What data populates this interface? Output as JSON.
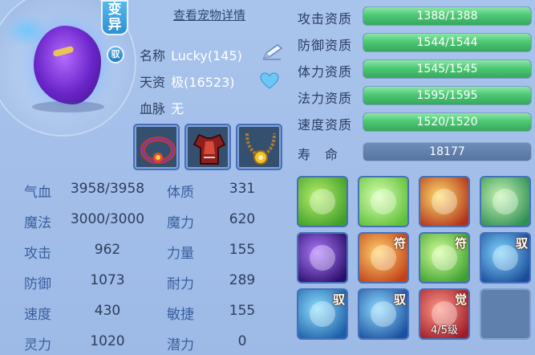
{
  "pet": {
    "mutant_tag": "变异",
    "ride_badge": "驭",
    "details_link": "查看宠物详情",
    "name_label": "名称",
    "name_value": "Lucky(145)",
    "talent_label": "天资",
    "talent_value": "极(16523)",
    "bloodline_label": "血脉",
    "bloodline_value": "无"
  },
  "attributes": [
    {
      "label": "气血",
      "value": "3958/3958"
    },
    {
      "label": "魔法",
      "value": "3000/3000"
    },
    {
      "label": "攻击",
      "value": "962"
    },
    {
      "label": "防御",
      "value": "1073"
    },
    {
      "label": "速度",
      "value": "430"
    },
    {
      "label": "灵力",
      "value": "1020"
    }
  ],
  "stats": [
    {
      "label": "体质",
      "value": "331"
    },
    {
      "label": "魔力",
      "value": "620"
    },
    {
      "label": "力量",
      "value": "155"
    },
    {
      "label": "耐力",
      "value": "289"
    },
    {
      "label": "敏捷",
      "value": "155"
    },
    {
      "label": "潜力",
      "value": "0"
    }
  ],
  "aptitudes": [
    {
      "label": "攻击资质",
      "text": "1388/1388",
      "fill": 1.0
    },
    {
      "label": "防御资质",
      "text": "1544/1544",
      "fill": 1.0
    },
    {
      "label": "体力资质",
      "text": "1545/1545",
      "fill": 1.0
    },
    {
      "label": "法力资质",
      "text": "1595/1595",
      "fill": 1.0
    },
    {
      "label": "速度资质",
      "text": "1520/1520",
      "fill": 1.0
    }
  ],
  "lifespan": {
    "label": "寿　命",
    "value": "18177"
  },
  "equipment": [
    "ring-icon",
    "armor-icon",
    "necklace-icon"
  ],
  "skills": [
    {
      "icon": "green-rays-hand-icon",
      "tag": "",
      "level": ""
    },
    {
      "icon": "heart-glow-icon",
      "tag": "",
      "level": ""
    },
    {
      "icon": "red-scroll-icon",
      "tag": "",
      "level": ""
    },
    {
      "icon": "green-wind-icon",
      "tag": "",
      "level": ""
    },
    {
      "icon": "purple-vortex-icon",
      "tag": "",
      "level": ""
    },
    {
      "icon": "fire-slash-icon",
      "tag": "符",
      "level": ""
    },
    {
      "icon": "pointing-hand-icon",
      "tag": "符",
      "level": ""
    },
    {
      "icon": "blue-beast-icon",
      "tag": "驭",
      "level": ""
    },
    {
      "icon": "shield-icon",
      "tag": "驭",
      "level": ""
    },
    {
      "icon": "blue-sword-icon",
      "tag": "驭",
      "level": ""
    },
    {
      "icon": "red-beam-icon",
      "tag": "觉",
      "level": "4/5级"
    },
    {
      "icon": "empty-slot",
      "tag": "",
      "level": ""
    }
  ],
  "colors": {
    "background": "#a9c4ec",
    "aptitude_fill": "#4ec775",
    "life_bar": "#6e8eb9",
    "label_blue": "#3a5f9f"
  }
}
